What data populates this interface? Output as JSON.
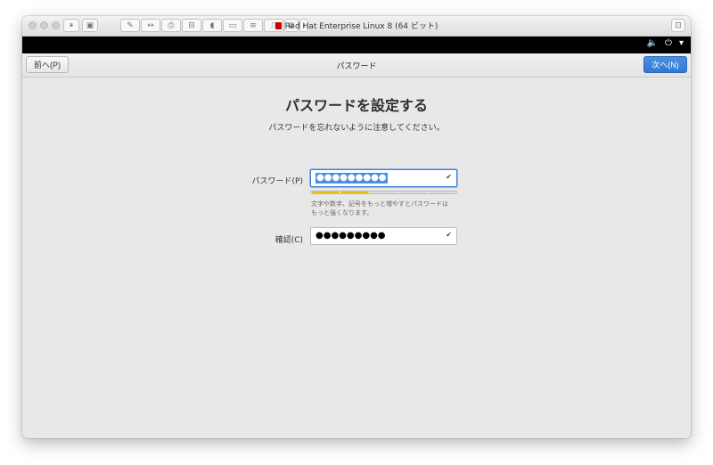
{
  "vm_window": {
    "title": "Red Hat Enterprise Linux 8 (64 ビット)",
    "toolbar_icons": [
      "pause-icon",
      "snapshot-icon",
      "wrench-icon",
      "network-icon",
      "printer-icon",
      "hdd-icon",
      "sound-icon",
      "camera-icon",
      "disk-icon",
      "usb-icon",
      "share-icon",
      "chevron-left-icon"
    ],
    "right_icon": "fullscreen-icon"
  },
  "system_bar": {
    "icons": [
      "volume-icon",
      "power-icon",
      "chevron-down-icon"
    ],
    "glyphs": {
      "volume": "🔈",
      "power": "⏻",
      "chevron": "▾"
    }
  },
  "header": {
    "prev_label": "前へ(P)",
    "title": "パスワード",
    "next_label": "次へ(N)",
    "accent": "#3478d0"
  },
  "main": {
    "heading": "パスワードを設定する",
    "subtitle": "パスワードを忘れないように注意してください。",
    "password": {
      "label": "パスワード(P)",
      "value": "●●●●●●●●●",
      "check": "✔",
      "strength_segments_on": 2,
      "strength_segments_total": 5,
      "strength_color": "#e5c107",
      "hint_line1": "文字や数字、記号をもっと増やすとパスワードは",
      "hint_line2": "もっと強くなります。"
    },
    "confirm": {
      "label": "確認(C)",
      "value": "●●●●●●●●●",
      "check": "✔"
    }
  }
}
